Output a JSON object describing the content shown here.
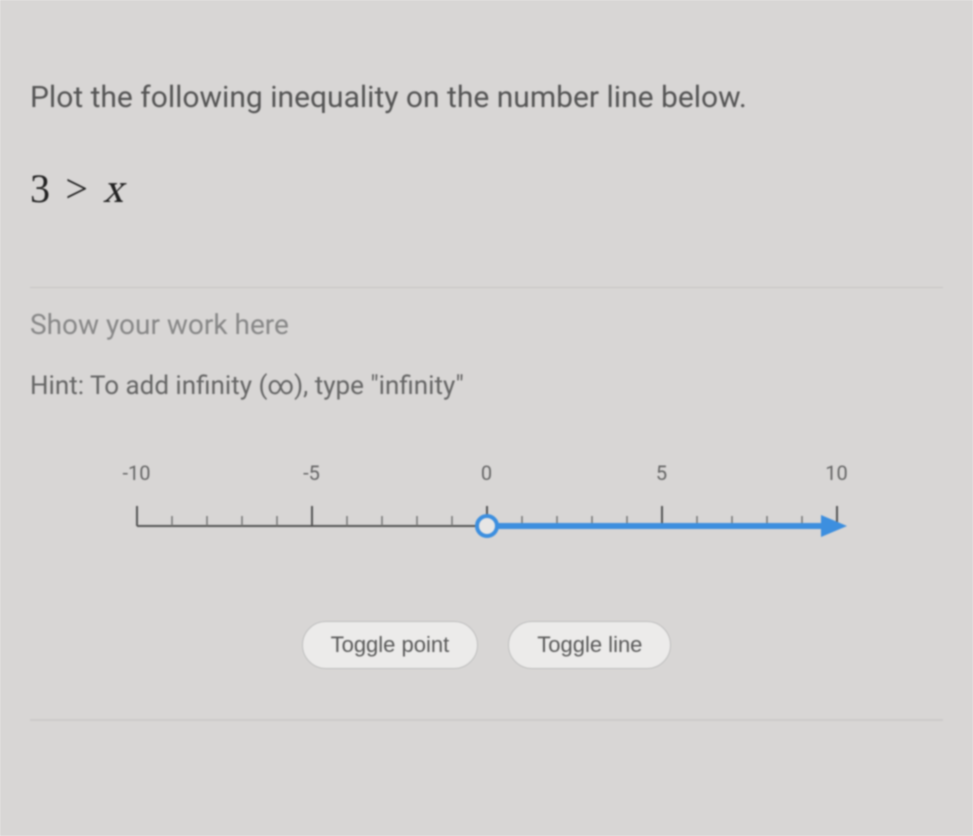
{
  "prompt": "Plot the following inequality on the number line below.",
  "inequality": {
    "lhs": "3",
    "op": ">",
    "rhs": "x"
  },
  "work_placeholder": "Show your work here",
  "hint": "Hint: To add infinity (∞), type \"infinity\"",
  "numberline": {
    "min": -10,
    "max": 10,
    "major_labels": [
      "-10",
      "-5",
      "0",
      "5",
      "10"
    ],
    "point_value": 0,
    "point_open": true,
    "ray_to": "right",
    "arrow": true,
    "color": "#3d8fdf"
  },
  "buttons": {
    "toggle_point": "Toggle point",
    "toggle_line": "Toggle line"
  },
  "chart_data": {
    "type": "line",
    "title": "",
    "xlabel": "",
    "ylabel": "",
    "xlim": [
      -10,
      10
    ],
    "categories": [
      "-10",
      "-5",
      "0",
      "5",
      "10"
    ],
    "series": [
      {
        "name": "ray",
        "values": [
          [
            0,
            0
          ],
          [
            10,
            0
          ]
        ],
        "open_start": true,
        "arrow_end": true
      }
    ]
  }
}
